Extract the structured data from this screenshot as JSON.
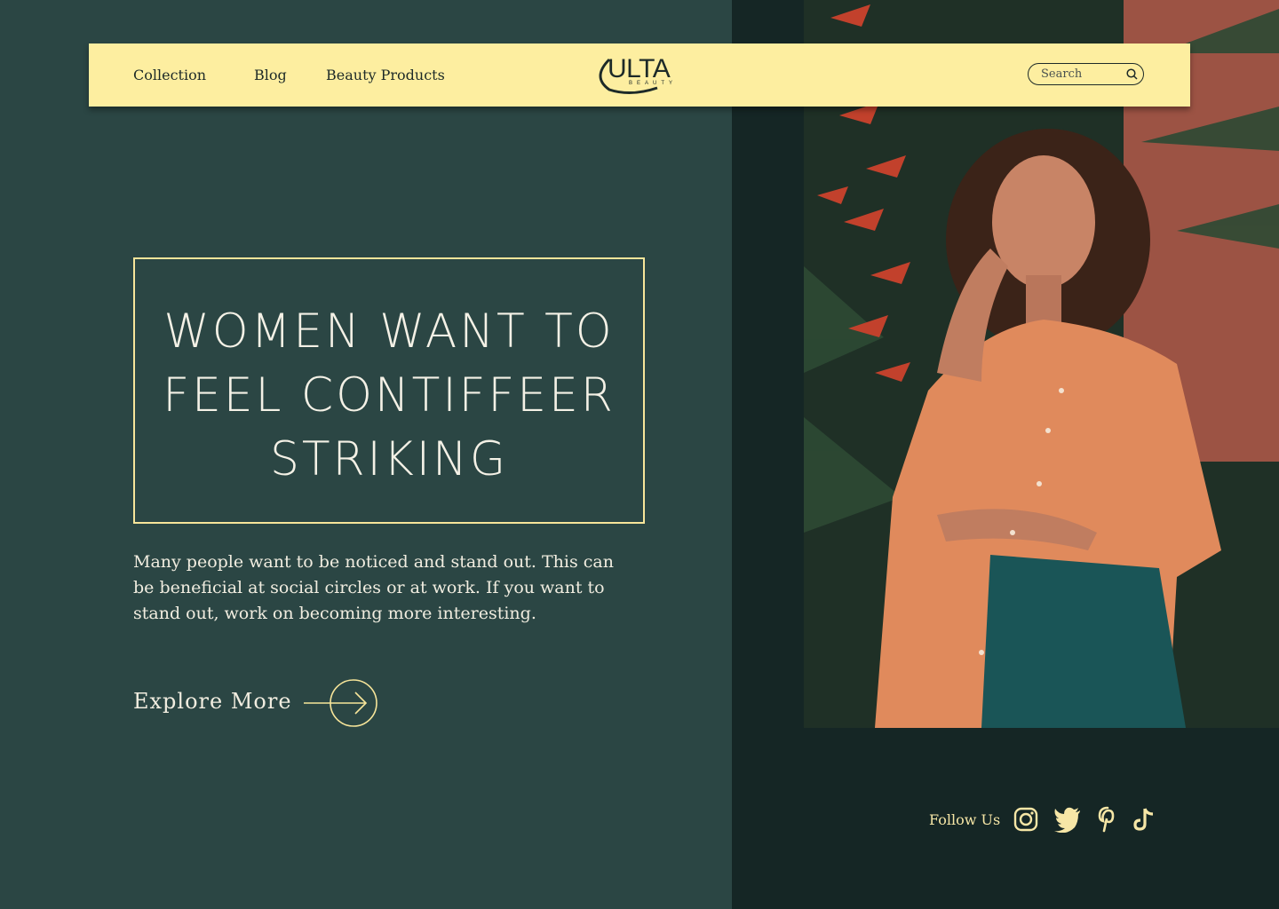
{
  "nav": {
    "links": [
      "Collection",
      "Blog",
      "Beauty Products"
    ],
    "logo_text": "ULTA",
    "logo_sub": "BEAUTY",
    "search_placeholder": "Search"
  },
  "hero": {
    "headline_lines": [
      "WOMEN WANT TO",
      "FEEL CONTIFFEER",
      "STRIKING"
    ],
    "body": "Many people want to be noticed and stand out. This can be beneficial at social circles or at work. If you want to stand out, work on becoming more interesting.",
    "cta_label": "Explore More"
  },
  "footer": {
    "follow_label": "Follow Us",
    "social_icons": [
      "instagram-icon",
      "twitter-icon",
      "pinterest-icon",
      "tiktok-icon"
    ]
  },
  "colors": {
    "accent": "#fdeea0",
    "left_bg": "#2b4644",
    "right_bg": "#152625",
    "text_light": "#f4f1e6"
  }
}
